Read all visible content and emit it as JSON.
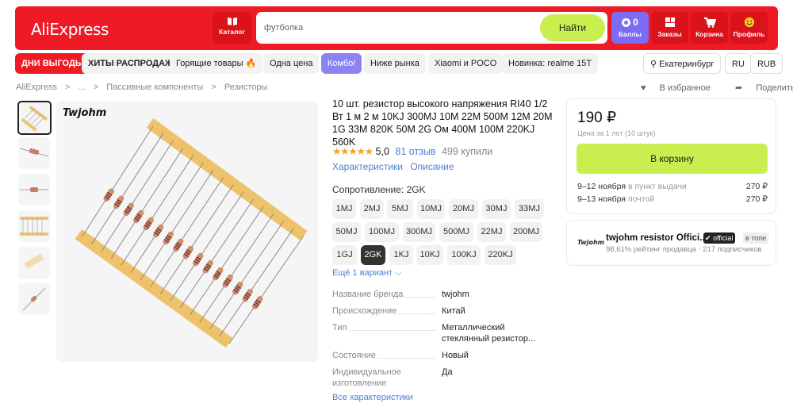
{
  "header": {
    "logo": "AliExpress",
    "catalog_label": "Каталог",
    "search_placeholder": "футболка",
    "search_button": "Найти",
    "balls_count": "0",
    "balls_label": "Баллы",
    "orders_label": "Заказы",
    "cart_label": "Корзина",
    "profile_label": "Профиль"
  },
  "nav": {
    "items": [
      "ДНИ ВЫГОДЫ",
      "ХИТЫ РАСПРОДАЖИ",
      "Горящие товары 🔥",
      "Одна цена",
      "Комбо!",
      "Ниже рынка",
      "Xiaomi и POCO",
      "Новинка: realme 15T"
    ],
    "location": "Екатеринбург",
    "lang": "RU",
    "currency": "RUB"
  },
  "breadcrumb": [
    "AliExpress",
    ">",
    "...",
    ">",
    "Пассивные компоненты",
    ">",
    "Резисторы"
  ],
  "actions": {
    "favorite": "В избранное",
    "share": "Поделиться"
  },
  "gallery": {
    "brand_logo": "Twjohm"
  },
  "product": {
    "title": "10 шт. резистор высокого напряжения RI40 1/2 Вт 1 м 2 м 10KJ 300MJ 10M 22M 500M 12M 20M 1G 33M 820K 50M 2G Ом 400M 100M 220KJ 560K",
    "stars": "★★★★★",
    "rating": "5,0",
    "reviews": "81 отзыв",
    "sold": "499 купили",
    "tab_specs": "Характеристики",
    "tab_desc": "Описание",
    "option_label": "Сопротивление: 2GK",
    "variants": [
      [
        "1MJ",
        "2MJ",
        "5MJ",
        "10MJ",
        "20MJ",
        "30MJ",
        "33MJ"
      ],
      [
        "50MJ",
        "100MJ",
        "300MJ",
        "500MJ",
        "22MJ",
        "200MJ"
      ],
      [
        "1GJ",
        "2GK",
        "1KJ",
        "10KJ",
        "100KJ",
        "220KJ"
      ]
    ],
    "selected_variant": "2GK",
    "more_variants": "Ещё 1 вариант",
    "specs": [
      {
        "k": "Название бренда",
        "v": "twjohm"
      },
      {
        "k": "Происхождение",
        "v": "Китай"
      },
      {
        "k": "Тип",
        "v": "Металлический стеклянный резистор..."
      },
      {
        "k": "Состояние",
        "v": "Новый"
      },
      {
        "k": "Индивидуальное изготовление",
        "v": "Да"
      }
    ],
    "all_specs": "Все характеристики"
  },
  "buy": {
    "price": "190 ₽",
    "price_note": "Цена за 1 лот (10 штук)",
    "cart_button": "В корзину",
    "delivery": [
      {
        "date": "9–12 ноября",
        "method": "в пункт выдачи",
        "price": "270 ₽"
      },
      {
        "date": "9–13 ноября",
        "method": "почтой",
        "price": "270 ₽"
      }
    ]
  },
  "seller": {
    "logo": "Twjohm",
    "name": "twjohm resistor Offici...",
    "official": "official",
    "top": "в топе",
    "sub": "98,61% рейтинг продавца · 217 подписчиков"
  },
  "colors": {
    "brand_red": "#ee1a25",
    "accent_lime": "#c9ee4f",
    "balls_purple": "#7b6cf6",
    "link_blue": "#4d7fd1"
  }
}
